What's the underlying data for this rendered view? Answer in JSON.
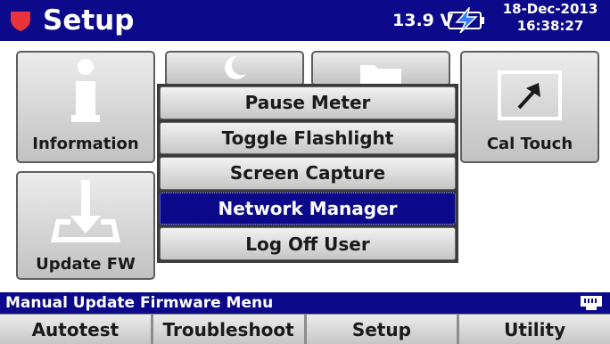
{
  "header": {
    "title": "Setup",
    "voltage": "13.9 V",
    "date": "18-Dec-2013",
    "time": "16:38:27",
    "app_icon": "shield-icon",
    "battery_icon": "battery-charging-icon"
  },
  "tiles": [
    {
      "label": "Information",
      "icon": "info-icon"
    },
    {
      "label": "",
      "icon": "moon-icon"
    },
    {
      "label": "",
      "icon": "folder-icon"
    },
    {
      "label": "Cal Touch",
      "icon": "cal-touch-icon"
    },
    {
      "label": "Update FW",
      "icon": "download-tray-icon"
    }
  ],
  "menu": {
    "items": [
      {
        "label": "Pause Meter"
      },
      {
        "label": "Toggle Flashlight"
      },
      {
        "label": "Screen Capture"
      },
      {
        "label": "Network Manager",
        "selected": true
      },
      {
        "label": "Log Off User"
      }
    ]
  },
  "status": {
    "text": "Manual Update Firmware Menu",
    "icon": "ethernet-icon"
  },
  "nav": {
    "tabs": [
      {
        "label": "Autotest"
      },
      {
        "label": "Troubleshoot"
      },
      {
        "label": "Setup"
      },
      {
        "label": "Utility"
      }
    ]
  },
  "colors": {
    "bar_blue": "#0c0a8a",
    "badge_red": "#e8323c",
    "battery_bolt": "#2f7cff"
  }
}
